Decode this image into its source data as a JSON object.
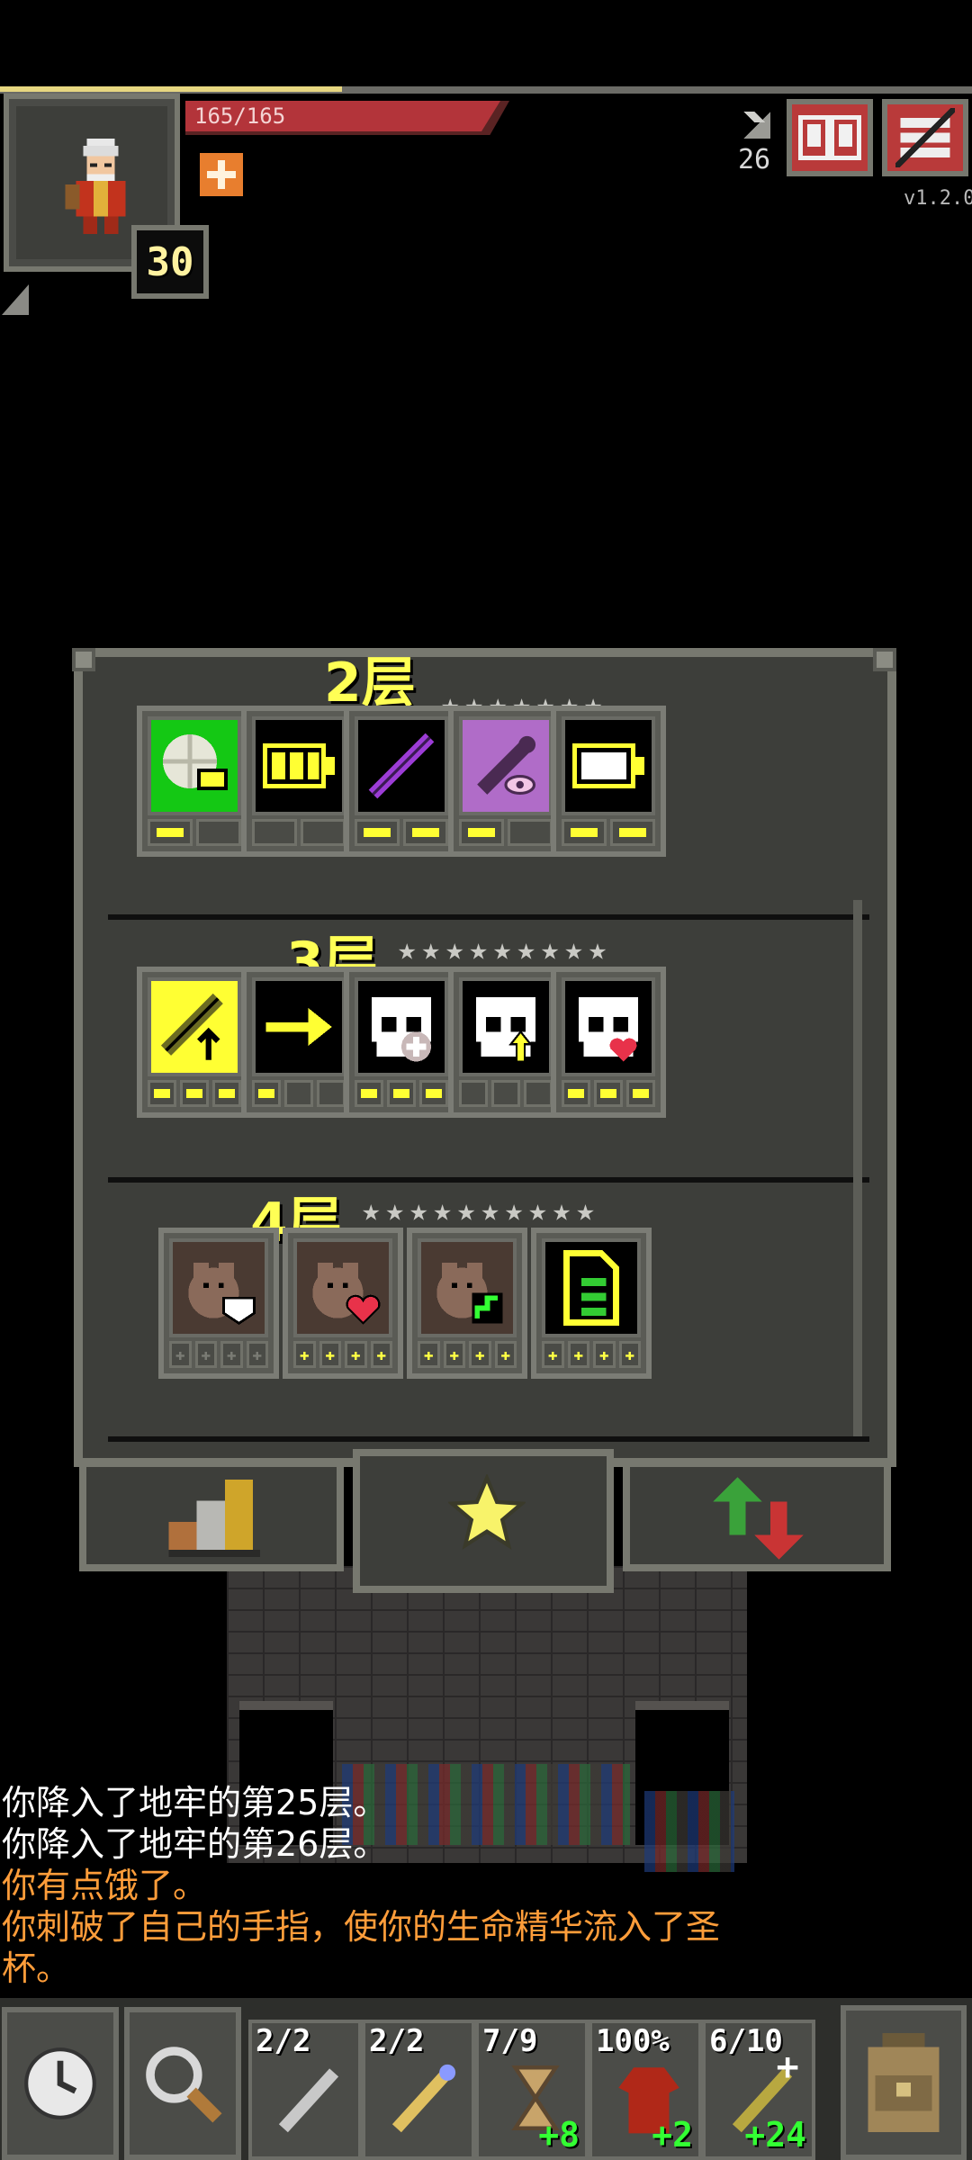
{
  "hud": {
    "hp_text": "165/165",
    "hp_fraction": 1.0,
    "level": "30",
    "depth": "26",
    "version": "v1.2.0",
    "buttons": [
      {
        "name": "journal-button",
        "icon": "journal-icon"
      },
      {
        "name": "menu-button",
        "icon": "menu-icon"
      }
    ]
  },
  "talents": {
    "tiers": [
      {
        "title": "2层",
        "stars": "★★★★★★★",
        "items": [
          {
            "icon": "ward-icon",
            "pips": [
              1,
              0
            ]
          },
          {
            "icon": "battery-icon",
            "pips": [
              0,
              0
            ]
          },
          {
            "icon": "purple-wand-icon",
            "pips": [
              1,
              1
            ]
          },
          {
            "icon": "wand-eye-icon",
            "pips": [
              1,
              0
            ]
          },
          {
            "icon": "empty-battery-icon",
            "pips": [
              1,
              1
            ]
          }
        ]
      },
      {
        "title": "3层",
        "stars": "★★★★★★★★★",
        "stars2": "★★",
        "items": [
          {
            "icon": "wand-upgrade-icon",
            "pips": [
              1,
              1,
              1
            ]
          },
          {
            "icon": "arrow-right-icon",
            "pips": [
              1,
              0,
              0
            ]
          },
          {
            "icon": "skull-plus-icon",
            "pips": [
              1,
              1,
              1
            ]
          },
          {
            "icon": "skull-arrow-icon",
            "pips": [
              0,
              0,
              0
            ]
          },
          {
            "icon": "skull-heart-icon",
            "pips": [
              1,
              1,
              1
            ]
          }
        ]
      },
      {
        "title": "4层",
        "stars": "★★★★★★★★★★",
        "stars2": "★★",
        "items": [
          {
            "icon": "rat-shield-icon",
            "pips": [
              0,
              0,
              0,
              0
            ]
          },
          {
            "icon": "rat-heart-icon",
            "pips": [
              1,
              1,
              1,
              1
            ]
          },
          {
            "icon": "rat-speed-icon",
            "pips": [
              1,
              1,
              1,
              1
            ]
          },
          {
            "icon": "ratmogrify-icon",
            "pips": [
              1,
              1,
              1,
              1
            ]
          }
        ]
      }
    ]
  },
  "tabs": [
    {
      "name": "tab-stats",
      "icon": "bar-chart-icon"
    },
    {
      "name": "tab-talents",
      "icon": "star-icon"
    },
    {
      "name": "tab-upgrades",
      "icon": "up-down-arrows-icon"
    }
  ],
  "log": [
    {
      "text": "你降入了地牢的第25层。",
      "style": "normal"
    },
    {
      "text": "你降入了地牢的第26层。",
      "style": "normal"
    },
    {
      "text": "你有点饿了。",
      "style": "warn"
    },
    {
      "text": "你刺破了自己的手指，使你的生命精华流入了圣",
      "style": "warn"
    },
    {
      "text": "杯。",
      "style": "warn"
    }
  ],
  "toolbar": {
    "wait_icon": "clock-icon",
    "search_icon": "magnifier-icon",
    "quickslots": [
      {
        "top": "2/2",
        "bottom": "",
        "icon": "wand-gray-icon"
      },
      {
        "top": "2/2",
        "bottom": "",
        "icon": "wand-gold-icon"
      },
      {
        "top": "7/9",
        "bottom": "+8",
        "icon": "hourglass-icon"
      },
      {
        "top": "100%",
        "bottom": "+2",
        "icon": "robe-icon"
      },
      {
        "top": "6/10",
        "bottom": "+24",
        "icon": "wand-sparkle-icon"
      }
    ],
    "backpack_icon": "backpack-icon"
  },
  "colors": {
    "tier_title": "#ffff55",
    "pip_on": "#ffff33",
    "log_warn": "#ff9d3a",
    "hp": "#b3343a",
    "upgrade_green": "#33ff33"
  }
}
